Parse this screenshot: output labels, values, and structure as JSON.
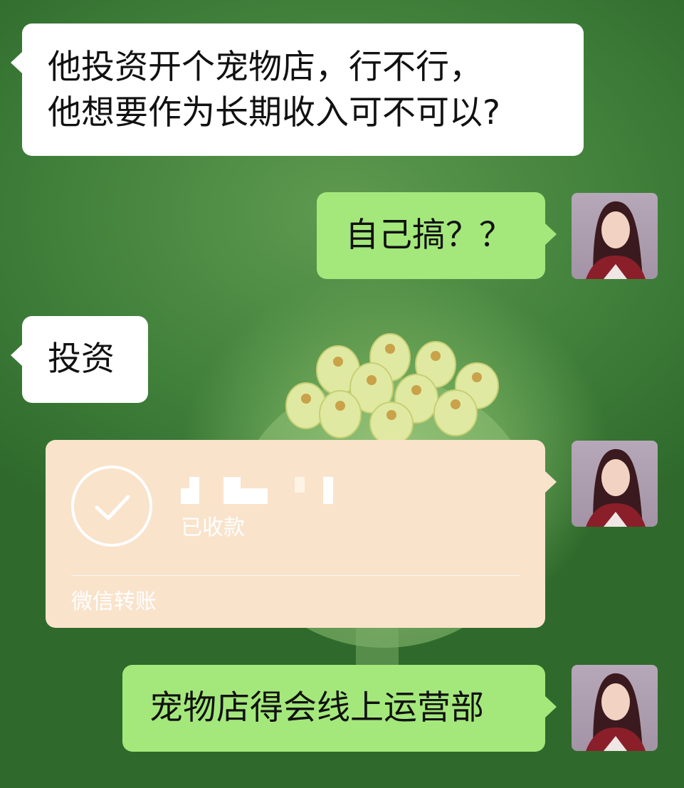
{
  "messages": [
    {
      "side": "left",
      "lines": [
        "他投资开个宠物店，行不行，",
        "他想要作为长期收入可不可以?"
      ]
    },
    {
      "side": "right",
      "text": "自己搞？？"
    },
    {
      "side": "left",
      "text": "投资"
    },
    {
      "side": "right",
      "type": "transfer",
      "status": "已收款",
      "label": "微信转账"
    },
    {
      "side": "right",
      "text": "宠物店得会线上运营部"
    }
  ],
  "icons": {
    "check": "check-circle-icon",
    "avatar": "avatar-woman"
  },
  "colors": {
    "white_bubble": "#ffffff",
    "green_bubble": "#a4e87c",
    "transfer_bubble": "#f9e3cb"
  }
}
